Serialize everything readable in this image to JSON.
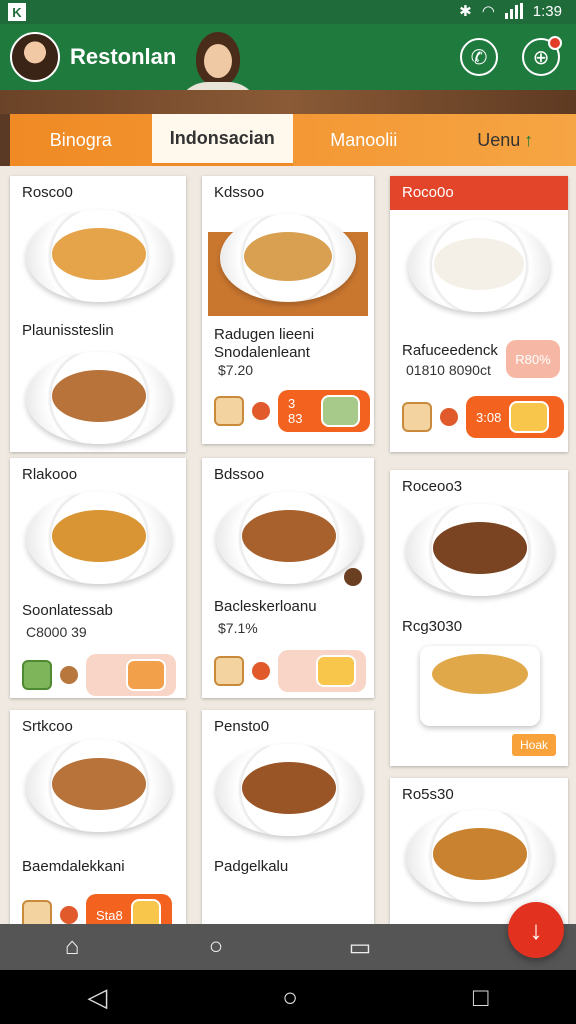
{
  "status": {
    "time": "1:39"
  },
  "app": {
    "title": "Restonlan"
  },
  "tabs": [
    {
      "label": "Binogra"
    },
    {
      "label": "Indonsacian"
    },
    {
      "label": "Manoolii"
    },
    {
      "label": "Uenu"
    }
  ],
  "cards": {
    "c1": {
      "head": "Rosco0",
      "title": "Plaunissteslin"
    },
    "c2": {
      "head": "Kdssoo",
      "title": "Radugen lieeni",
      "subtitle": "Snodalenleant",
      "price": "$7.20",
      "order_label": "3 83"
    },
    "c3": {
      "head": "Roco0o",
      "title": "Rafuceedenck",
      "subtitle": "01810 8090ct",
      "badge": "R80%",
      "order_label": "3:08"
    },
    "c4": {
      "head": "Rlakooo",
      "title": "Soonlatessab",
      "subtitle": "C8000 39"
    },
    "c5": {
      "head": "Bdssoo",
      "title": "Bacleskerloanu",
      "price": "$7.1%"
    },
    "c6": {
      "head": "Roceoo3",
      "title": "Rcg3030",
      "tag": "Hoak"
    },
    "c7": {
      "head": "Srtkcoo",
      "title": "Baemdalekkani",
      "order_label": "Sta8"
    },
    "c8": {
      "head": "Pensto0",
      "title": "Padgelkalu"
    },
    "c9": {
      "head": "Ro5s30"
    }
  },
  "colors": {
    "brand_green": "#1f7a3e",
    "accent_orange": "#f08a24",
    "fab_red": "#e3311f"
  }
}
